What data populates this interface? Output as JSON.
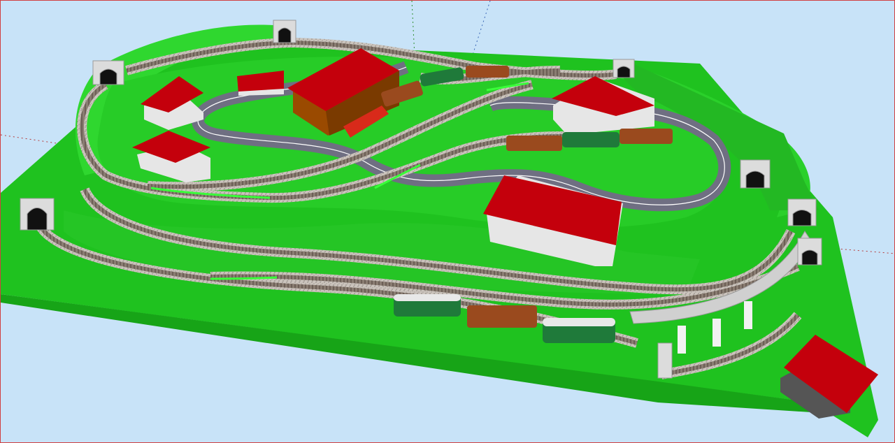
{
  "viewport": {
    "type": "3d-track-planner-view",
    "background_color": "#c8e3f8",
    "frame_color": "#d04040"
  },
  "scene": {
    "baseboard_color": "#1fc21f",
    "baseboard_edge_color": "#17a417",
    "hill_color": "#2fd72f",
    "track_color": "#9c9087",
    "ballast_color": "#c9c2bb",
    "road_color": "#6f6f82",
    "road_marking_color": "#ffffff",
    "roof_color": "#c4000c",
    "wall_color": "#e6e6e6",
    "tunnel_portal_color": "#d9d9d9",
    "wagon_brown": "#9a4a1e",
    "coach_green": "#1f7a3a",
    "locomotive_red": "#d82a1a",
    "selected_track_color": "#39ff39",
    "axes": [
      {
        "name": "green-axis",
        "color": "#2e8f2e"
      },
      {
        "name": "blue-axis",
        "color": "#3a66b5"
      },
      {
        "name": "red-axis",
        "color": "#b53a3a"
      }
    ]
  }
}
